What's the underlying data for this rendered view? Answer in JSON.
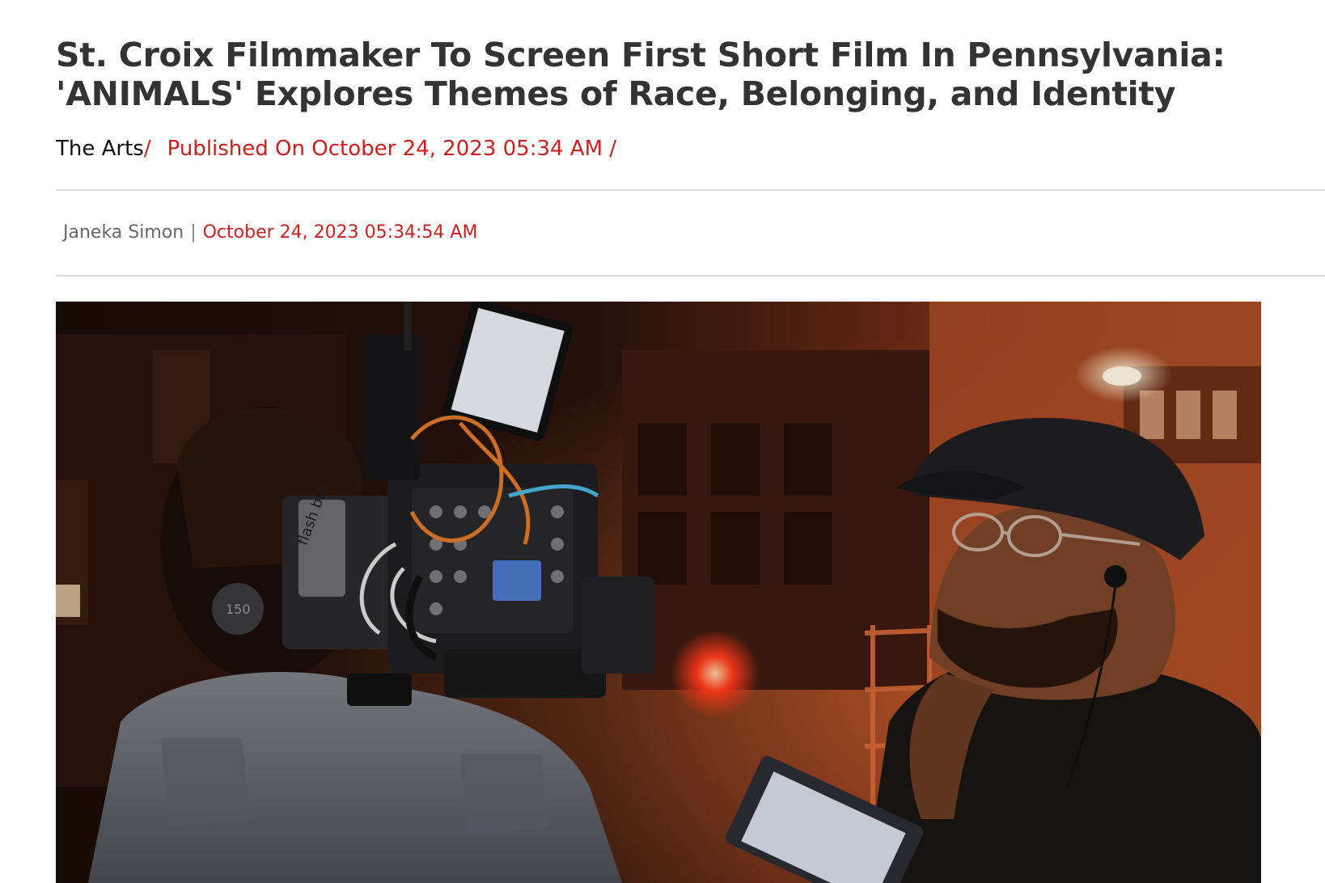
{
  "article": {
    "title": "St. Croix Filmmaker To Screen First Short Film In Pennsylvania: 'ANIMALS' Explores Themes of Race, Belonging, and Identity",
    "category": "The Arts",
    "separator": "/",
    "published": "Published On October 24, 2023 05:34 AM /",
    "author": "Janeka Simon",
    "byline_separator": "|",
    "byline_date": "October 24, 2023 05:34:54 AM"
  },
  "hero_image": {
    "camera_labels": {
      "battery_brand": "flash box",
      "battery_number": "150"
    }
  },
  "colors": {
    "headline": "#333333",
    "accent_red": "#cc1f1f",
    "divider": "#dddddd"
  }
}
